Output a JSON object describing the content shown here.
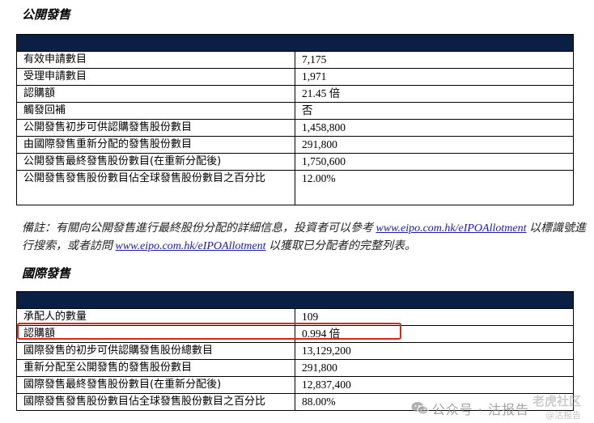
{
  "public_offer": {
    "title": "公開發售",
    "rows": [
      {
        "label": "有效申請數目",
        "value": "7,175"
      },
      {
        "label": "受理申請數目",
        "value": "1,971"
      },
      {
        "label": "認購額",
        "value": "21.45 倍"
      },
      {
        "label": "觸發回補",
        "value": "否"
      },
      {
        "label": "公開發售初步可供認購發售股份數目",
        "value": "1,458,800"
      },
      {
        "label": "由國際發售重新分配的發售股份數目",
        "value": "291,800"
      },
      {
        "label": "公開發售最終發售股份數目(在重新分配後)",
        "value": "1,750,600"
      },
      {
        "label": "公開發售發售股份數目佔全球發售股份數目之百分比",
        "value": "12.00%"
      }
    ]
  },
  "note": {
    "prefix": "備註：有關向公開發售進行最終股份分配的詳細信息，投資者可以參考",
    "link1": "www.eipo.com.hk/eIPOAllotment",
    "middle": "以標識號進行搜索，或者訪問",
    "link2": "www.eipo.com.hk/eIPOAllotment",
    "suffix": "以獲取已分配者的完整列表。"
  },
  "international_offer": {
    "title": "國際發售",
    "rows": [
      {
        "label": "承配人的數量",
        "value": "109"
      },
      {
        "label": "認購額",
        "value": "0.994 倍"
      },
      {
        "label": "國際發售的初步可供認購發售股份總數目",
        "value": "13,129,200"
      },
      {
        "label": "重新分配至公開發售的發售股份數目",
        "value": "291,800"
      },
      {
        "label": "國際發售最終發售股份數目(在重新分配後)",
        "value": "12,837,400"
      },
      {
        "label": "國際發售發售股份數目佔全球發售股份數目之百分比",
        "value": "88.00%"
      }
    ]
  },
  "watermark": {
    "text": "公众号 · 沽报告",
    "brand": "老虎社区",
    "sub": "@沽报告",
    "icon": "wechat-icon"
  },
  "colors": {
    "table_header": "#0b1f45",
    "highlight": "#e0221b",
    "link": "#1a1ab0"
  }
}
